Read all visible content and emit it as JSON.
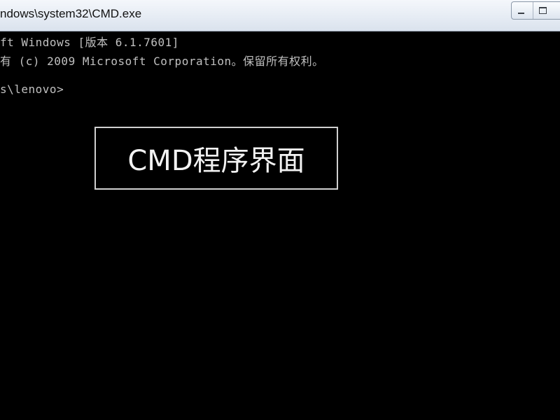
{
  "window": {
    "title": "ndows\\system32\\CMD.exe",
    "controls": {
      "minimize_icon": "minimize-icon",
      "maximize_icon": "maximize-icon"
    }
  },
  "console": {
    "lines": [
      "ft Windows [版本 6.1.7601]",
      "有 (c) 2009 Microsoft Corporation。保留所有权利。",
      "",
      "s\\lenovo>"
    ],
    "text_color": "#c0c0c0",
    "background": "#000000"
  },
  "overlay_label": {
    "text": "CMD程序界面"
  }
}
